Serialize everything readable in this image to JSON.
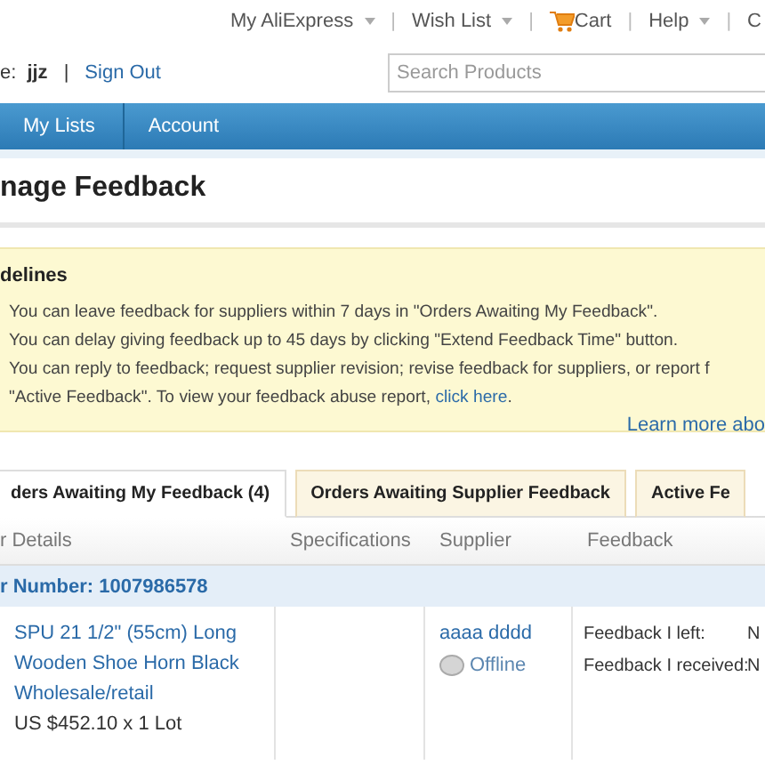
{
  "top_links": [
    {
      "label": "My AliExpress",
      "dropdown": true,
      "kind": "menu"
    },
    {
      "label": "Wish List",
      "dropdown": true,
      "kind": "menu"
    },
    {
      "label": "Cart",
      "dropdown": false,
      "kind": "cart"
    },
    {
      "label": "Help",
      "dropdown": true,
      "kind": "menu"
    },
    {
      "label": "C",
      "dropdown": false,
      "kind": "menu"
    }
  ],
  "top_separators": [
    "|",
    "|",
    "|",
    "|"
  ],
  "user": {
    "greeting": "e:",
    "name": "jjz",
    "separator": "|",
    "sign_out": "Sign Out"
  },
  "search": {
    "placeholder": "Search Products"
  },
  "nav": [
    {
      "label": "My Lists"
    },
    {
      "label": "Account"
    }
  ],
  "page_title": "nage Feedback",
  "guidelines": {
    "title": "delines",
    "items": [
      "You can leave feedback for suppliers within 7 days in \"Orders Awaiting My Feedback\".",
      "You can delay giving feedback up to 45 days by clicking \"Extend Feedback Time\" button.",
      "You can reply to feedback; request supplier revision; revise feedback for suppliers, or report f"
    ],
    "continuation": "\"Active Feedback\". To view your feedback abuse report,",
    "link": "click here",
    "continuation_end": ".",
    "learn_more": "Learn more abo"
  },
  "tabs": [
    {
      "label": "ders Awaiting My Feedback (4)",
      "selected": true
    },
    {
      "label": "Orders Awaiting Supplier Feedback",
      "selected": false
    },
    {
      "label": "Active Fe",
      "selected": false
    }
  ],
  "table": {
    "columns": [
      "r Details",
      "Specifications",
      "Supplier",
      "Feedback"
    ],
    "order": {
      "number": "r Number: 1007986578"
    },
    "item": {
      "product_lines": [
        "SPU 21 1/2\" (55cm) Long",
        "Wooden Shoe Horn Black",
        "Wholesale/retail"
      ],
      "price": "US $452.10 x 1 Lot",
      "supplier": "aaaa dddd",
      "status": "Offline",
      "online": false,
      "feedback": [
        {
          "label": "Feedback I left:",
          "value": "N"
        },
        {
          "label": "Feedback I received:",
          "value": "N"
        }
      ]
    }
  }
}
